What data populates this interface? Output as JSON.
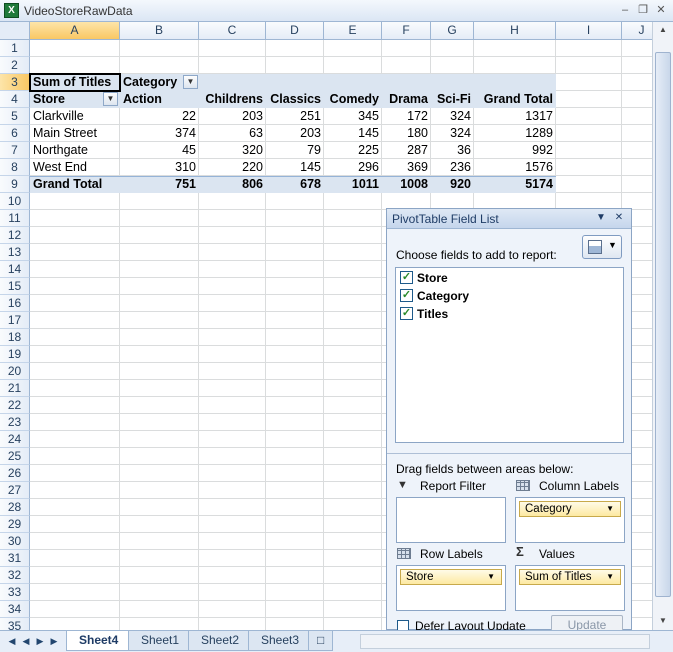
{
  "window": {
    "title": "VideoStoreRawData",
    "app_icon": "excel-icon"
  },
  "columns": [
    "A",
    "B",
    "C",
    "D",
    "E",
    "F",
    "G",
    "H",
    "I",
    "J"
  ],
  "rows": [
    "1",
    "2",
    "3",
    "4",
    "5",
    "6",
    "7",
    "8",
    "9",
    "10",
    "11",
    "12",
    "13",
    "14",
    "15",
    "16",
    "17",
    "18",
    "19",
    "20",
    "21",
    "22",
    "23",
    "24",
    "25",
    "26",
    "27",
    "28",
    "29",
    "30",
    "31",
    "32",
    "33",
    "34",
    "35"
  ],
  "pivot": {
    "corner_label": "Sum of Titles",
    "col_field": "Category",
    "row_field": "Store",
    "categories": [
      "Action",
      "Childrens",
      "Classics",
      "Comedy",
      "Drama",
      "Sci-Fi",
      "Grand Total"
    ],
    "data_rows": [
      {
        "store": "Clarkville",
        "v": [
          "22",
          "203",
          "251",
          "345",
          "172",
          "324",
          "1317"
        ]
      },
      {
        "store": "Main Street",
        "v": [
          "374",
          "63",
          "203",
          "145",
          "180",
          "324",
          "1289"
        ]
      },
      {
        "store": "Northgate",
        "v": [
          "45",
          "320",
          "79",
          "225",
          "287",
          "36",
          "992"
        ]
      },
      {
        "store": "West End",
        "v": [
          "310",
          "220",
          "145",
          "296",
          "369",
          "236",
          "1576"
        ]
      }
    ],
    "total_label": "Grand Total",
    "totals": [
      "751",
      "806",
      "678",
      "1011",
      "1008",
      "920",
      "5174"
    ]
  },
  "field_list": {
    "title": "PivotTable Field List",
    "choose_label": "Choose fields to add to report:",
    "fields": [
      {
        "name": "Store",
        "checked": true
      },
      {
        "name": "Category",
        "checked": true
      },
      {
        "name": "Titles",
        "checked": true
      }
    ],
    "drag_label": "Drag fields between areas below:",
    "report_filter": "Report Filter",
    "column_labels": "Column Labels",
    "row_labels": "Row Labels",
    "values": "Values",
    "column_chip": "Category",
    "row_chip": "Store",
    "values_chip": "Sum of Titles",
    "defer_label": "Defer Layout Update",
    "update_button": "Update"
  },
  "sheets": [
    "Sheet4",
    "Sheet1",
    "Sheet2",
    "Sheet3"
  ],
  "active_sheet": "Sheet4"
}
